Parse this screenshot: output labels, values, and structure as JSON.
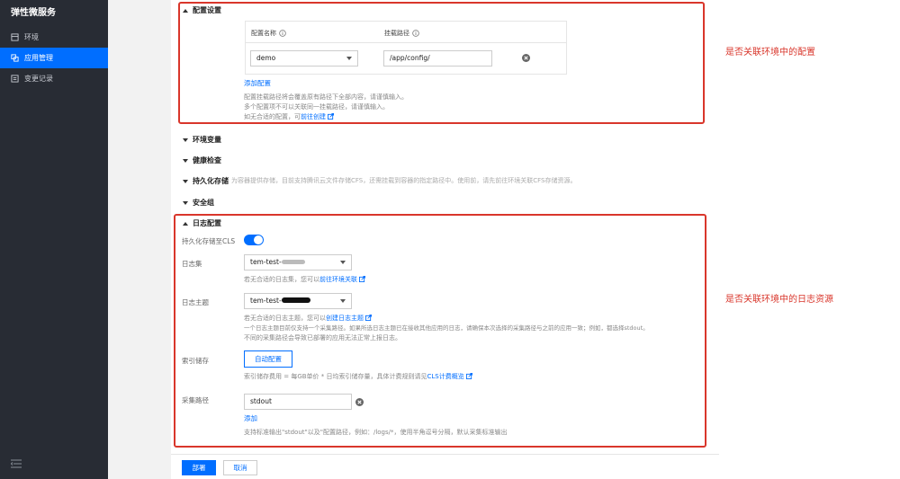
{
  "sidebar": {
    "brand": "弹性微服务",
    "items": [
      {
        "label": "环境",
        "icon": "environment-icon"
      },
      {
        "label": "应用管理",
        "icon": "app-management-icon",
        "active": true
      },
      {
        "label": "变更记录",
        "icon": "change-log-icon"
      }
    ]
  },
  "config_section": {
    "title": "配置设置",
    "col_name": "配置名称",
    "col_path": "挂载路径",
    "row_name": "demo",
    "row_path": "/app/config/",
    "add_link": "添加配置",
    "hint1": "配置挂载路径将会覆盖原有路径下全部内容，请谨慎输入。",
    "hint2": "多个配置项不可以关联同一挂载路径，请谨慎输入。",
    "hint3_prefix": "如无合适的配置，可",
    "hint3_link": "前往创建"
  },
  "sections": {
    "env_vars": "环境变量",
    "health_check": "健康检查",
    "persistent_storage": "持久化存储",
    "persistent_storage_hint": "为容器提供存储，目前支持腾讯云文件存储CFS，还需挂载到容器的指定路径中。使用前，请先前往环境关联CFS存储资源。",
    "security_group": "安全组"
  },
  "log_section": {
    "title": "日志配置",
    "cls_label": "持久化存储至CLS",
    "cls_enabled": true,
    "logset_label": "日志集",
    "logset_value": "tem-test-",
    "logset_hint_prefix": "若无合适的日志集，您可以",
    "logset_hint_link": "前往环境关联",
    "topic_label": "日志主题",
    "topic_value": "tem-test-",
    "topic_hint_prefix": "若无合适的日志主题，您可以",
    "topic_hint_link": "创建日志主题",
    "topic_hint2": "一个日志主题目前仅支持一个采集路径。如果所选日志主题已在接收其他应用的日志，请确保本次选择的采集路径与之前的应用一致；例如，都选择stdout。",
    "topic_hint3": "不同的采集路径会导致已部署的应用无法正常上报日志。",
    "index_label": "索引储存",
    "index_button": "自动配置",
    "index_hint_prefix": "索引储存费用 = 每GB单价 * 日均索引储存量，具体计费规则请见",
    "index_hint_link": "CLS计费概览",
    "path_label": "采集路径",
    "path_value": "stdout",
    "add_link": "添加",
    "path_hint": "支持标准输出\"stdout\"以及\"配置路径，例如：/logs/*，使用半角逗号分隔，默认采集标准输出"
  },
  "annotations": {
    "config": "是否关联环境中的配置",
    "log": "是否关联环境中的日志资源"
  },
  "footer": {
    "deploy": "部署",
    "cancel": "取消"
  },
  "colors": {
    "accent": "#006eff",
    "sidebar_bg": "#282c34",
    "annotation_red": "#d9362b"
  }
}
